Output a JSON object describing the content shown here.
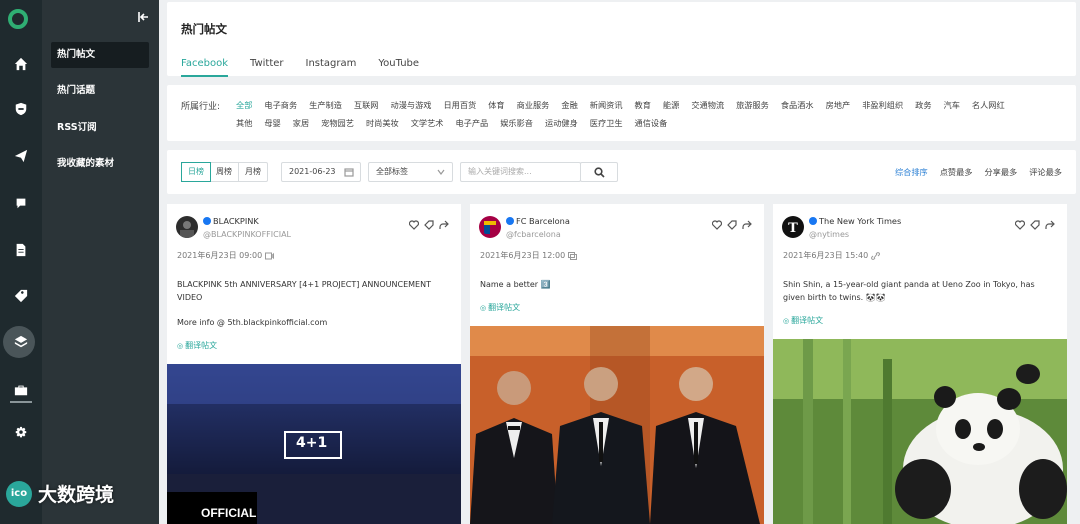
{
  "sidebar": {
    "menu_items": [
      "热门帖文",
      "热门话题",
      "RSS订阅",
      "我收藏的素材"
    ],
    "icons": [
      "logo-icon",
      "home-icon",
      "shield-icon",
      "send-icon",
      "chat-icon",
      "document-icon",
      "tag-icon",
      "layers-icon",
      "toolbox-icon",
      "gear-icon"
    ]
  },
  "page": {
    "title": "热门帖文",
    "tabs": [
      "Facebook",
      "Twitter",
      "Instagram",
      "YouTube"
    ],
    "active_tab": "Facebook"
  },
  "industry": {
    "label": "所属行业:",
    "categories": [
      "全部",
      "电子商务",
      "生产制造",
      "互联网",
      "动漫与游戏",
      "日用百货",
      "体育",
      "商业服务",
      "金融",
      "新闻资讯",
      "教育",
      "能源",
      "交通物流",
      "旅游服务",
      "食品酒水",
      "房地产",
      "非盈利组织",
      "政务",
      "汽车",
      "名人网红",
      "其他",
      "母婴",
      "家居",
      "宠物园艺",
      "时尚美妆",
      "文学艺术",
      "电子产品",
      "娱乐影音",
      "运动健身",
      "医疗卫生",
      "通信设备"
    ],
    "selected": "全部"
  },
  "filters": {
    "period": [
      "日榜",
      "周榜",
      "月榜"
    ],
    "period_selected": "日榜",
    "date": "2021-06-23",
    "tag_select": "全部标签",
    "search_placeholder": "输入关键词搜索...",
    "sort_options": [
      "综合排序",
      "点赞最多",
      "分享最多",
      "评论最多"
    ],
    "sort_selected": "综合排序"
  },
  "cards": [
    {
      "account": "BLACKPINK",
      "handle": "@BLACKPINKOFFICIAL",
      "time": "2021年6月23日 09:00",
      "text": "BLACKPINK 5th ANNIVERSARY [4+1 PROJECT] ANNOUNCEMENT VIDEO",
      "text2": "More info @ 5th.blackpinkofficial.com",
      "translate": "翻译帖文",
      "media_label": "4+1",
      "media_caption": "OFFICIAL"
    },
    {
      "account": "FC Barcelona",
      "handle": "@fcbarcelona",
      "time": "2021年6月23日 12:00",
      "text": "Name a better 3️⃣",
      "translate": "翻译帖文"
    },
    {
      "account": "The New York Times",
      "handle": "@nytimes",
      "time": "2021年6月23日 15:40",
      "text": "Shin Shin, a 15-year-old giant panda at Ueno Zoo in Tokyo, has given birth to twins. 🐼🐼",
      "translate": "翻译帖文"
    }
  ],
  "watermark": "大数跨境",
  "colors": {
    "accent": "#2aa79b",
    "sidebar": "#1f2a2e",
    "menu": "#2b3438",
    "facebook": "#1877f2",
    "sort_active": "#2a7fd4"
  }
}
